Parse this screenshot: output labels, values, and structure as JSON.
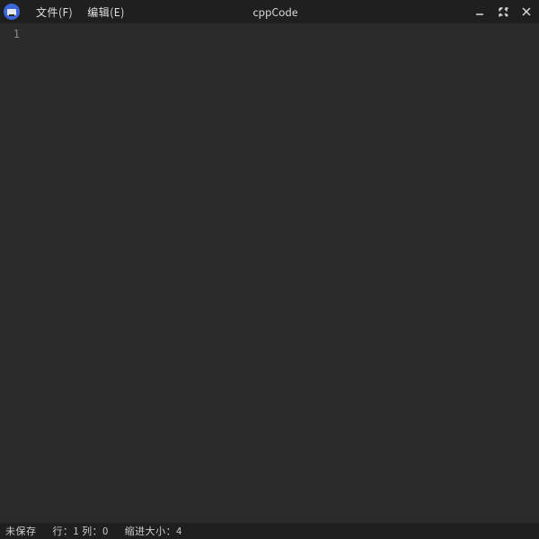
{
  "menu": {
    "file": "文件(F)",
    "edit": "编辑(E)"
  },
  "title": "cppCode",
  "editor": {
    "lines": [
      "1"
    ]
  },
  "status": {
    "save_state": "未保存",
    "cursor": "行：1 列：0",
    "indent": "缩进大小：4"
  }
}
